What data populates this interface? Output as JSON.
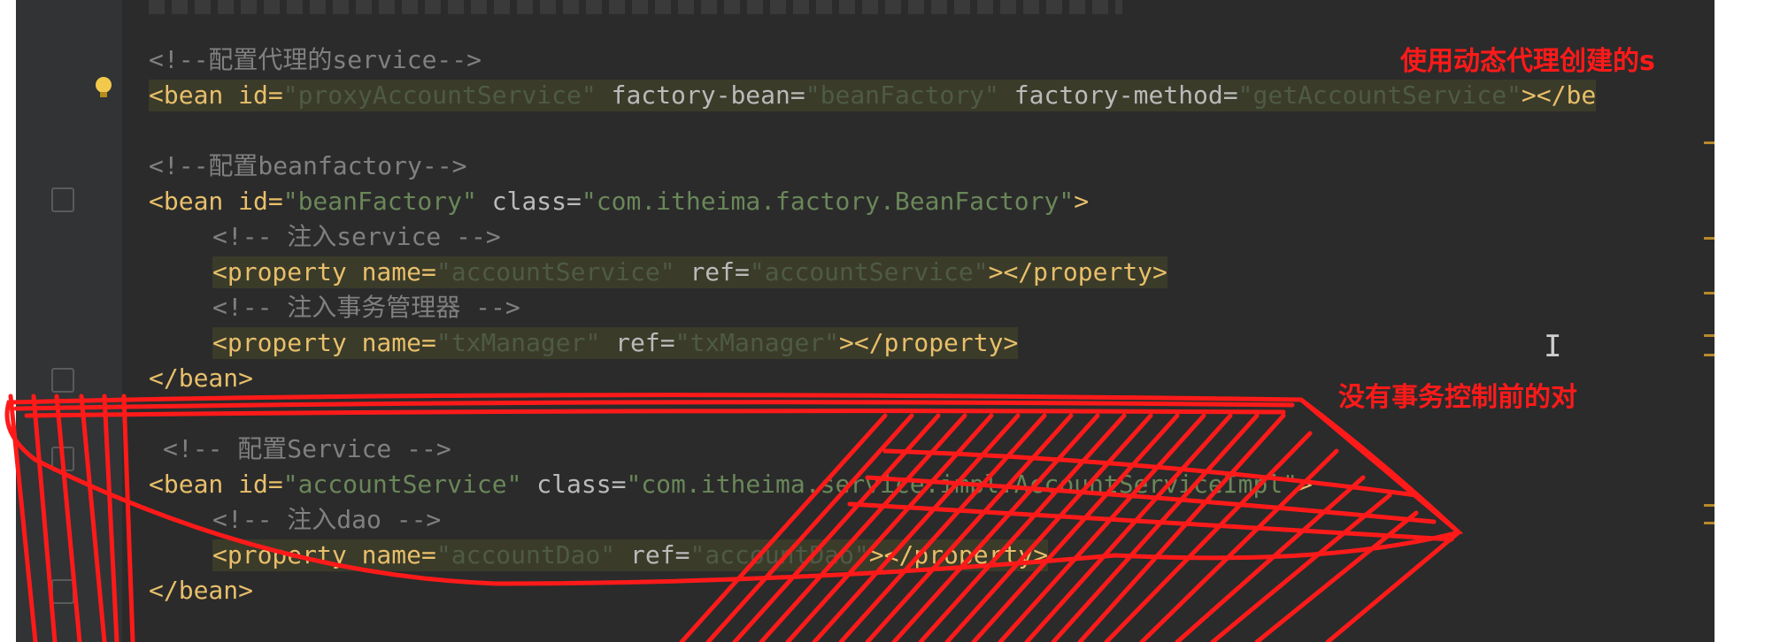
{
  "editor": {
    "lines": {
      "l1": "<!--配置代理的service-->",
      "l2a": "<bean id=",
      "l2b": "\"proxyAccountService\"",
      "l2c": " factory-bean=",
      "l2d": "\"beanFactory\"",
      "l2e": " factory-method=",
      "l2f": "\"getAccountService\"",
      "l2g": "></be",
      "l3": "<!--配置beanfactory-->",
      "l4a": "<bean id=",
      "l4b": "\"beanFactory\"",
      "l4c": " class=",
      "l4d": "\"com.itheima.factory.BeanFactory\"",
      "l4e": ">",
      "l5": "<!-- 注入service -->",
      "l6a": "<property name=",
      "l6b": "\"accountService\"",
      "l6c": " ref=",
      "l6d": "\"accountService\"",
      "l6e": "></property>",
      "l7": "<!-- 注入事务管理器 -->",
      "l8a": "<property name=",
      "l8b": "\"txManager\"",
      "l8c": " ref=",
      "l8d": "\"txManager\"",
      "l8e": "></property>",
      "l9": "</bean>",
      "l10": "<!-- 配置Service -->",
      "l11a": "<bean id=",
      "l11b": "\"accountService\"",
      "l11c": " class=",
      "l11d": "\"com.itheima.service.impl.AccountServiceImpl\"",
      "l11e": ">",
      "l12": "<!-- 注入dao -->",
      "l13a": "<property name=",
      "l13b": "\"accountDao\"",
      "l13c": " ref=",
      "l13d": "\"accountDao\"",
      "l13e": "></property>",
      "l14": "</bean>"
    }
  },
  "annotations": {
    "top_right": "使用动态代理创建的s",
    "mid_right": "没有事务控制前的对"
  },
  "colors": {
    "editor_bg": "#2b2b2b",
    "tag": "#e8bf6a",
    "attr_value": "#6a8759",
    "comment": "#808080",
    "annotation": "#ff1a1a"
  }
}
